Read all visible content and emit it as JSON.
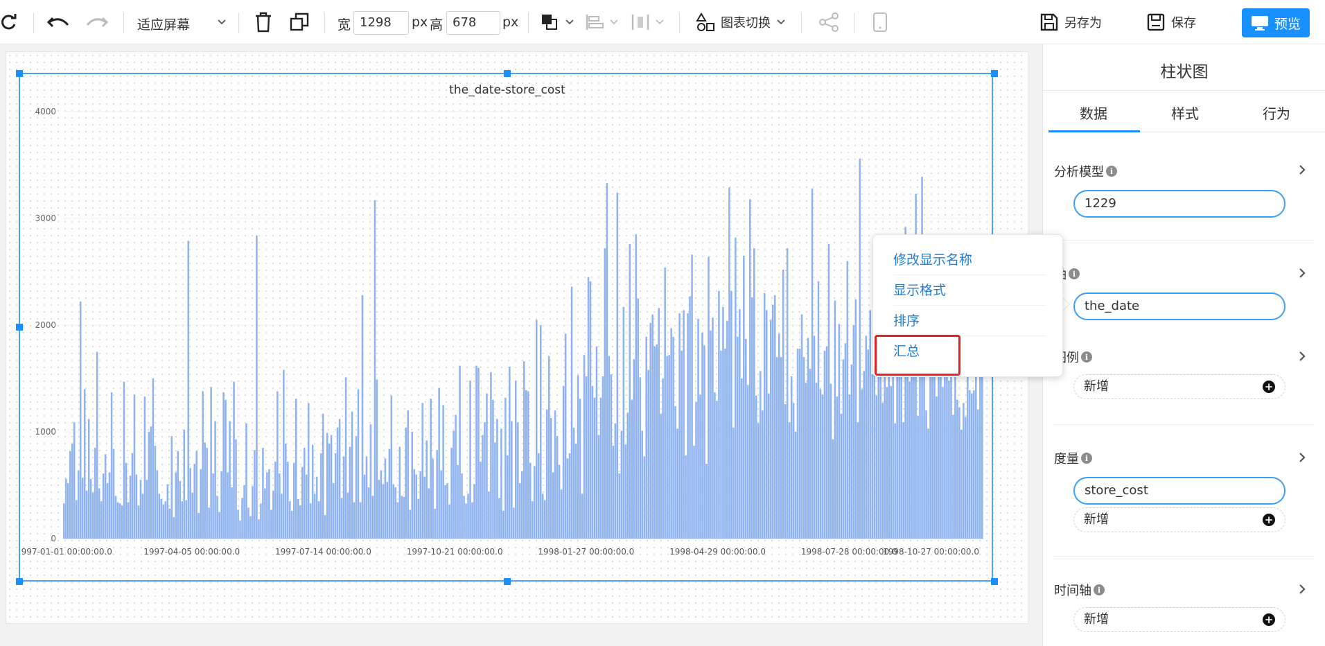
{
  "toolbar": {
    "fit_label": "适应屏幕",
    "width_label": "宽",
    "width_value": "1298",
    "px1": "px",
    "height_label": "高",
    "height_value": "678",
    "px2": "px",
    "chart_switch_label": "图表切换",
    "save_as_label": "另存为",
    "save_label": "保存",
    "preview_label": "预览"
  },
  "panel": {
    "title": "柱状图",
    "tabs": [
      "数据",
      "样式",
      "行为"
    ],
    "sections": {
      "model": {
        "label": "分析模型",
        "value": "1229"
      },
      "axis": {
        "label": "轴",
        "value": "the_date"
      },
      "legend": {
        "label": "图例",
        "add": "新增"
      },
      "measure": {
        "label": "度量",
        "value": "store_cost",
        "add": "新增"
      },
      "timeline": {
        "label": "时间轴",
        "add": "新增"
      }
    }
  },
  "context_menu": {
    "items": [
      "修改显示名称",
      "显示格式",
      "排序",
      "汇总"
    ]
  },
  "colors": {
    "accent": "#1890ff",
    "bar": "#8fb3f0",
    "highlight": "#e62020"
  },
  "chart_data": {
    "type": "bar",
    "title": "the_date-store_cost",
    "ylim": [
      0,
      4000
    ],
    "yticks": [
      "0",
      "1000",
      "2000",
      "3000",
      "4000"
    ],
    "xticks": [
      "1997-01-01 00:00:00.0",
      "1997-04-05 00:00:00.0",
      "1997-07-14 00:00:00.0",
      "1997-10-21 00:00:00.0",
      "1998-01-27 00:00:00.0",
      "1998-04-29 00:00:00.0",
      "1998-07-28 00:00:00.0",
      "1998-10-27 00:00:00.0"
    ],
    "x_start": "1997-01-01",
    "x_end": "1998-12-31",
    "values": [
      330,
      560,
      520,
      820,
      890,
      1090,
      360,
      640,
      2220,
      570,
      1400,
      450,
      1120,
      560,
      430,
      850,
      1750,
      470,
      350,
      610,
      790,
      520,
      620,
      1370,
      840,
      400,
      340,
      330,
      310,
      1470,
      710,
      340,
      590,
      800,
      1350,
      600,
      310,
      550,
      420,
      1330,
      550,
      1000,
      1050,
      1500,
      870,
      640,
      420,
      370,
      320,
      350,
      510,
      280,
      960,
      200,
      620,
      820,
      540,
      350,
      1020,
      360,
      2790,
      660,
      430,
      700,
      820,
      240,
      650,
      1380,
      900,
      850,
      290,
      1420,
      610,
      1100,
      400,
      250,
      630,
      1370,
      1300,
      620,
      1100,
      480,
      1470,
      930,
      270,
      170,
      380,
      500,
      1080,
      290,
      210,
      490,
      830,
      2840,
      180,
      330,
      850,
      470,
      620,
      650,
      270,
      450,
      720,
      1380,
      610,
      420,
      1580,
      890,
      720,
      350,
      260,
      710,
      1310,
      370,
      310,
      670,
      850,
      600,
      1270,
      330,
      880,
      420,
      580,
      350,
      800,
      1170,
      220,
      990,
      890,
      970,
      520,
      800,
      1040,
      1120,
      380,
      770,
      1510,
      430,
      860,
      1190,
      340,
      960,
      1400,
      340,
      2280,
      600,
      770,
      480,
      1070,
      400,
      3170,
      1490,
      550,
      640,
      510,
      750,
      530,
      840,
      1340,
      510,
      480,
      340,
      860,
      400,
      390,
      1040,
      1200,
      270,
      1000,
      650,
      600,
      370,
      630,
      1270,
      580,
      920,
      470,
      1310,
      750,
      280,
      830,
      1410,
      640,
      1250,
      500,
      520,
      320,
      850,
      1010,
      1160,
      690,
      1620,
      610,
      400,
      330,
      420,
      1480,
      340,
      510,
      1620,
      1600,
      720,
      970,
      1090,
      1360,
      440,
      1560,
      1300,
      900,
      1120,
      380,
      1030,
      260,
      1320,
      780,
      1610,
      1100,
      290,
      1480,
      1090,
      520,
      630,
      1660,
      1390,
      1380,
      710,
      350,
      680,
      2050,
      800,
      2000,
      420,
      360,
      1210,
      1710,
      1130,
      620,
      1200,
      960,
      690,
      460,
      1430,
      1920,
      750,
      800,
      2360,
      1040,
      890,
      1530,
      1310,
      420,
      1720,
      1520,
      2450,
      2410,
      1430,
      1320,
      1800,
      970,
      1320,
      1520,
      2720,
      3330,
      1710,
      1540,
      870,
      1080,
      3240,
      610,
      1010,
      2170,
      880,
      1180,
      2760,
      1300,
      1680,
      2850,
      2250,
      1510,
      1010,
      770,
      1890,
      1580,
      2020,
      2100,
      1800,
      1820,
      2160,
      1170,
      1500,
      2540,
      1710,
      1720,
      1970,
      1890,
      1240,
      1030,
      2110,
      1760,
      2140,
      780,
      2110,
      2270,
      2660,
      870,
      1280,
      2060,
      1350,
      1930,
      1810,
      700,
      2640,
      1950,
      2070,
      1370,
      1290,
      2320,
      1760,
      2170,
      1780,
      2040,
      3290,
      2320,
      1040,
      2820,
      1890,
      2150,
      1500,
      2650,
      1870,
      1440,
      3180,
      2260,
      2720,
      1340,
      1080,
      1570,
      1200,
      2300,
      2140,
      1360,
      2050,
      2190,
      2280,
      1700,
      1920,
      1700,
      2520,
      1260,
      2720,
      1090,
      1520,
      1270,
      1000,
      1780,
      1780,
      2100,
      1700,
      1460,
      1880,
      1590,
      3280,
      1900,
      1460,
      2410,
      1400,
      1350,
      1760,
      1800,
      2760,
      1450,
      930,
      2230,
      1330,
      2010,
      1170,
      1680,
      1830,
      2600,
      1350,
      1630,
      2000,
      2240,
      1090,
      3560,
      1400,
      1570,
      1900,
      1770,
      2140,
      1540,
      1770,
      1340,
      1880,
      2060,
      1270,
      2510,
      1420,
      1870,
      1430,
      1630,
      1080,
      1540,
      1960,
      1580,
      1090,
      2920,
      1860,
      1470,
      2000,
      2080,
      3230,
      1150,
      2050,
      3390,
      1560,
      1200,
      1030,
      2020,
      1860,
      1990,
      1330,
      1660,
      2270,
      1420,
      1570,
      1890,
      1480,
      2630,
      1160,
      1880,
      1300,
      1230,
      1020,
      1270,
      1140,
      1870,
      1390,
      1360,
      1390,
      1560,
      1210,
      2060,
      1680
    ]
  }
}
